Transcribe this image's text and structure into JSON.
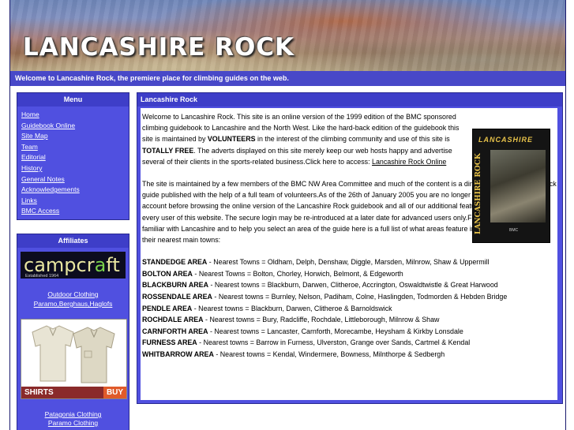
{
  "header": {
    "title": "LANCASHIRE ROCK",
    "tagline": "Welcome to Lancashire Rock, the premiere place for climbing guides on the web."
  },
  "menu": {
    "heading": "Menu",
    "items": [
      {
        "label": "Home"
      },
      {
        "label": "Guidebook Online"
      },
      {
        "label": "Site Map"
      },
      {
        "label": "Team"
      },
      {
        "label": "Editorial"
      },
      {
        "label": "History"
      },
      {
        "label": "General Notes"
      },
      {
        "label": "Acknowledgements"
      },
      {
        "label": "Links"
      },
      {
        "label": "BMC Access"
      }
    ]
  },
  "affiliates": {
    "heading": "Affiliates",
    "campcraft": {
      "word_a": "campcr",
      "word_b": "a",
      "word_c": "ft",
      "est": "Established 1964"
    },
    "outdoor_link_1": "Outdoor Clothing",
    "outdoor_link_2": "Paramo,Berghaus,Haglofs",
    "shirts_label": "SHIRTS",
    "buy_label": "BUY",
    "patagonia_link": "Patagonia Clothing",
    "paramo_link": "Paramo Clothing"
  },
  "content": {
    "heading": "Lancashire Rock",
    "p1_a": "Welcome to Lancashire Rock. This site is an online version of the 1999 edition of the BMC sponsored climbing guidebook to Lancashire and the North West. Like the hard-back edition of the guidebook this site is maintained by ",
    "p1_b": "VOLUNTEERS",
    "p1_c": " in the interest of the climbing community and use of this site is ",
    "p1_d": "TOTALLY FREE",
    "p1_e": ". The adverts displayed on this site merely keep our web hosts happy and advertise several of their clients in the sports-related business.Click here to access: ",
    "p1_link": "Lancashire Rock Online",
    "p2": "The site is maintained by a few members of the BMC NW Area Committee and much of the content is a direct replica of the hard-back guide published with the help of a full team of volunteers.As of the 26th of January 2005 you are no longer required to register an account before browsing the online version of the Lancashire Rock guidebook and all of our additional features will be available to every user of this website. The secure login may be re-introduced at a later date for advanced users only.For users that are not familiar with Lancashire and to help you select an area of the guide here is a full list of what areas feature in Lancashire Rock and their nearest main towns:",
    "areas": [
      {
        "name": "STANDEDGE AREA",
        "towns": " - Nearest Towns = Oldham, Delph, Denshaw, Diggle, Marsden, Milnrow, Shaw & Uppermill"
      },
      {
        "name": "BOLTON AREA",
        "towns": " - Nearest Towns = Bolton, Chorley, Horwich, Belmont, & Edgeworth"
      },
      {
        "name": "BLACKBURN AREA",
        "towns": " - Nearest towns = Blackburn, Darwen, Clitheroe, Accrington, Oswaldtwistle & Great Harwood"
      },
      {
        "name": "ROSSENDALE AREA",
        "towns": " - Nearest towns = Burnley, Nelson, Padiham, Colne, Haslingden, Todmorden & Hebden Bridge"
      },
      {
        "name": "PENDLE AREA",
        "towns": " - Nearest towns = Blackburn, Darwen, Clitheroe & Barnoldswick"
      },
      {
        "name": "ROCHDALE AREA",
        "towns": " - Nearest towns = Bury, Radcliffe, Rochdale, Littleborough, Milnrow & Shaw"
      },
      {
        "name": "CARNFORTH AREA",
        "towns": " - Nearest towns = Lancaster, Carnforth, Morecambe, Heysham & Kirkby Lonsdale"
      },
      {
        "name": "FURNESS AREA",
        "towns": " - Nearest towns = Barrow in Furness, Ulverston, Grange over Sands, Cartmel & Kendal"
      },
      {
        "name": "WHITBARROW AREA",
        "towns": " - Nearest towns = Kendal, Windermere, Bowness, Milnthorpe & Sedbergh"
      }
    ],
    "book": {
      "top": "LANCASHIRE",
      "spine": "LANCASHIRE ROCK",
      "publisher": "BMC"
    }
  },
  "colors": {
    "panel_blue": "#5050e0",
    "header_blue": "#3e3ec8",
    "tagline_blue": "#4848c8"
  }
}
